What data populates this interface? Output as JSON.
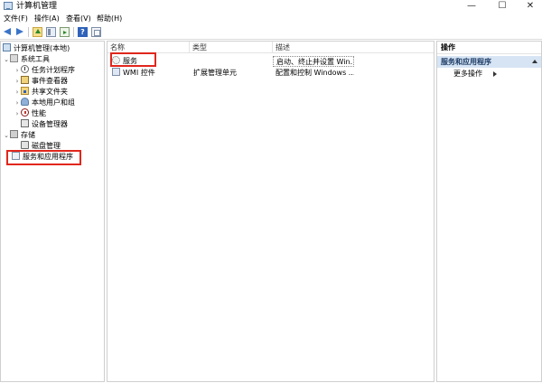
{
  "window": {
    "title": "计算机管理"
  },
  "window_controls": {
    "minimize": "—",
    "maximize": "☐",
    "close": "✕"
  },
  "menu": [
    {
      "label": "文件(F)"
    },
    {
      "label": "操作(A)"
    },
    {
      "label": "查看(V)"
    },
    {
      "label": "帮助(H)"
    }
  ],
  "toolbar": {
    "help_label": "?"
  },
  "tree": {
    "root": "计算机管理(本地)",
    "system_tools": "系统工具",
    "task_scheduler": "任务计划程序",
    "event_viewer": "事件查看器",
    "shared_folders": "共享文件夹",
    "local_users_groups": "本地用户和组",
    "performance": "性能",
    "device_manager": "设备管理器",
    "storage": "存储",
    "disk_management": "磁盘管理",
    "services_apps": "服务和应用程序"
  },
  "list": {
    "columns": {
      "name": "名称",
      "type": "类型",
      "description": "描述"
    },
    "rows": [
      {
        "name": "服务",
        "type": "",
        "description": "启动、终止并设置 Win..."
      },
      {
        "name": "WMI 控件",
        "type": "扩展管理单元",
        "description": "配置和控制 Windows ..."
      }
    ]
  },
  "actions": {
    "header": "操作",
    "section": "服务和应用程序",
    "more": "更多操作"
  },
  "colors": {
    "highlight": "#e1261c",
    "selection": "#d6e4f4"
  }
}
